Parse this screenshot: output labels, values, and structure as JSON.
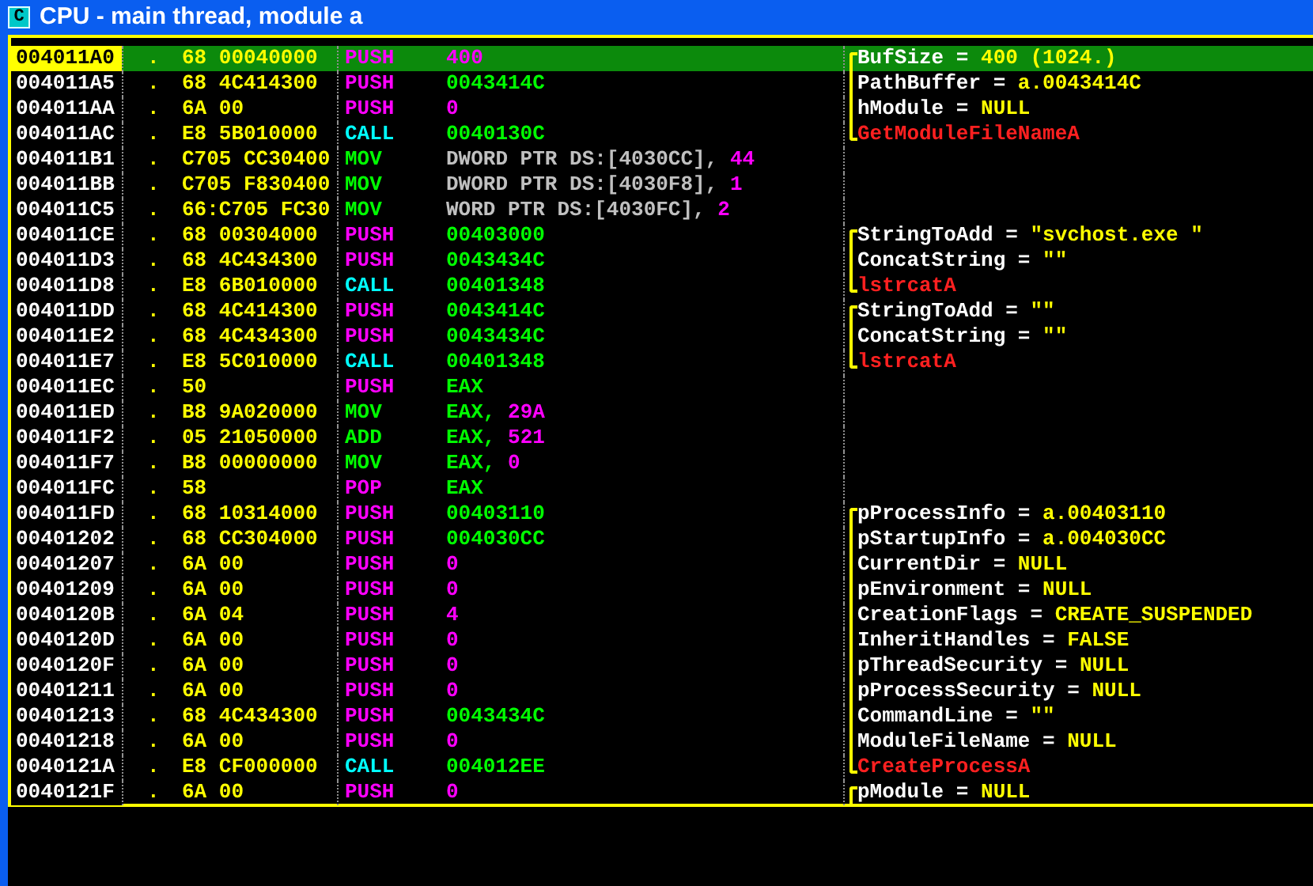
{
  "window": {
    "icon_letter": "C",
    "title": "CPU - main thread, module a"
  },
  "rows": [
    {
      "address": "004011A0",
      "selected": true,
      "dot": ".",
      "hex": "68 00040000",
      "mnemonic": {
        "text": "PUSH",
        "kind": "push"
      },
      "operands": [
        {
          "text": "400",
          "kind": "const"
        }
      ],
      "comment": {
        "kind": "start",
        "parts": [
          {
            "text": "BufSize = ",
            "kind": "name"
          },
          {
            "text": "400 (1024.)",
            "kind": "value"
          }
        ]
      }
    },
    {
      "address": "004011A5",
      "selected": false,
      "dot": ".",
      "hex": "68 4C414300",
      "mnemonic": {
        "text": "PUSH",
        "kind": "push"
      },
      "operands": [
        {
          "text": "0043414C",
          "kind": "addr"
        }
      ],
      "comment": {
        "kind": "mid",
        "parts": [
          {
            "text": "PathBuffer = ",
            "kind": "name"
          },
          {
            "text": "a.0043414C",
            "kind": "value"
          }
        ]
      }
    },
    {
      "address": "004011AA",
      "selected": false,
      "dot": ".",
      "hex": "6A 00",
      "mnemonic": {
        "text": "PUSH",
        "kind": "push"
      },
      "operands": [
        {
          "text": "0",
          "kind": "const"
        }
      ],
      "comment": {
        "kind": "mid",
        "parts": [
          {
            "text": "hModule = ",
            "kind": "name"
          },
          {
            "text": "NULL",
            "kind": "value"
          }
        ]
      }
    },
    {
      "address": "004011AC",
      "selected": false,
      "dot": ".",
      "hex": "E8 5B010000",
      "mnemonic": {
        "text": "CALL",
        "kind": "call"
      },
      "operands": [
        {
          "text": "0040130C",
          "kind": "addr"
        }
      ],
      "comment": {
        "kind": "end",
        "parts": [
          {
            "text": "GetModuleFileNameA",
            "kind": "func"
          }
        ]
      }
    },
    {
      "address": "004011B1",
      "selected": false,
      "dot": ".",
      "hex": "C705 CC30400",
      "mnemonic": {
        "text": "MOV",
        "kind": "mov"
      },
      "operands": [
        {
          "text": "DWORD PTR DS:[4030CC], ",
          "kind": "mem"
        },
        {
          "text": "44",
          "kind": "const"
        }
      ]
    },
    {
      "address": "004011BB",
      "selected": false,
      "dot": ".",
      "hex": "C705 F830400",
      "mnemonic": {
        "text": "MOV",
        "kind": "mov"
      },
      "operands": [
        {
          "text": "DWORD PTR DS:[4030F8], ",
          "kind": "mem"
        },
        {
          "text": "1",
          "kind": "const"
        }
      ]
    },
    {
      "address": "004011C5",
      "selected": false,
      "dot": ".",
      "hex": "66:C705 FC30",
      "mnemonic": {
        "text": "MOV",
        "kind": "mov"
      },
      "operands": [
        {
          "text": "WORD PTR DS:[4030FC], ",
          "kind": "mem"
        },
        {
          "text": "2",
          "kind": "const"
        }
      ]
    },
    {
      "address": "004011CE",
      "selected": false,
      "dot": ".",
      "hex": "68 00304000",
      "mnemonic": {
        "text": "PUSH",
        "kind": "push"
      },
      "operands": [
        {
          "text": "00403000",
          "kind": "addr"
        }
      ],
      "comment": {
        "kind": "start",
        "parts": [
          {
            "text": "StringToAdd = ",
            "kind": "name"
          },
          {
            "text": "\"svchost.exe \"",
            "kind": "value"
          }
        ]
      }
    },
    {
      "address": "004011D3",
      "selected": false,
      "dot": ".",
      "hex": "68 4C434300",
      "mnemonic": {
        "text": "PUSH",
        "kind": "push"
      },
      "operands": [
        {
          "text": "0043434C",
          "kind": "addr"
        }
      ],
      "comment": {
        "kind": "mid",
        "parts": [
          {
            "text": "ConcatString = ",
            "kind": "name"
          },
          {
            "text": "\"\"",
            "kind": "value"
          }
        ]
      }
    },
    {
      "address": "004011D8",
      "selected": false,
      "dot": ".",
      "hex": "E8 6B010000",
      "mnemonic": {
        "text": "CALL",
        "kind": "call"
      },
      "operands": [
        {
          "text": "00401348",
          "kind": "addr"
        }
      ],
      "comment": {
        "kind": "end",
        "parts": [
          {
            "text": "lstrcatA",
            "kind": "func"
          }
        ]
      }
    },
    {
      "address": "004011DD",
      "selected": false,
      "dot": ".",
      "hex": "68 4C414300",
      "mnemonic": {
        "text": "PUSH",
        "kind": "push"
      },
      "operands": [
        {
          "text": "0043414C",
          "kind": "addr"
        }
      ],
      "comment": {
        "kind": "start",
        "parts": [
          {
            "text": "StringToAdd = ",
            "kind": "name"
          },
          {
            "text": "\"\"",
            "kind": "value"
          }
        ]
      }
    },
    {
      "address": "004011E2",
      "selected": false,
      "dot": ".",
      "hex": "68 4C434300",
      "mnemonic": {
        "text": "PUSH",
        "kind": "push"
      },
      "operands": [
        {
          "text": "0043434C",
          "kind": "addr"
        }
      ],
      "comment": {
        "kind": "mid",
        "parts": [
          {
            "text": "ConcatString = ",
            "kind": "name"
          },
          {
            "text": "\"\"",
            "kind": "value"
          }
        ]
      }
    },
    {
      "address": "004011E7",
      "selected": false,
      "dot": ".",
      "hex": "E8 5C010000",
      "mnemonic": {
        "text": "CALL",
        "kind": "call"
      },
      "operands": [
        {
          "text": "00401348",
          "kind": "addr"
        }
      ],
      "comment": {
        "kind": "end",
        "parts": [
          {
            "text": "lstrcatA",
            "kind": "func"
          }
        ]
      }
    },
    {
      "address": "004011EC",
      "selected": false,
      "dot": ".",
      "hex": "50",
      "mnemonic": {
        "text": "PUSH",
        "kind": "push"
      },
      "operands": [
        {
          "text": "EAX",
          "kind": "reg"
        }
      ]
    },
    {
      "address": "004011ED",
      "selected": false,
      "dot": ".",
      "hex": "B8 9A020000",
      "mnemonic": {
        "text": "MOV",
        "kind": "mov"
      },
      "operands": [
        {
          "text": "EAX, ",
          "kind": "reg"
        },
        {
          "text": "29A",
          "kind": "const"
        }
      ]
    },
    {
      "address": "004011F2",
      "selected": false,
      "dot": ".",
      "hex": "05 21050000",
      "mnemonic": {
        "text": "ADD",
        "kind": "mov"
      },
      "operands": [
        {
          "text": "EAX, ",
          "kind": "reg"
        },
        {
          "text": "521",
          "kind": "const"
        }
      ]
    },
    {
      "address": "004011F7",
      "selected": false,
      "dot": ".",
      "hex": "B8 00000000",
      "mnemonic": {
        "text": "MOV",
        "kind": "mov"
      },
      "operands": [
        {
          "text": "EAX, ",
          "kind": "reg"
        },
        {
          "text": "0",
          "kind": "const"
        }
      ]
    },
    {
      "address": "004011FC",
      "selected": false,
      "dot": ".",
      "hex": "58",
      "mnemonic": {
        "text": "POP",
        "kind": "push"
      },
      "operands": [
        {
          "text": "EAX",
          "kind": "reg"
        }
      ]
    },
    {
      "address": "004011FD",
      "selected": false,
      "dot": ".",
      "hex": "68 10314000",
      "mnemonic": {
        "text": "PUSH",
        "kind": "push"
      },
      "operands": [
        {
          "text": "00403110",
          "kind": "addr"
        }
      ],
      "comment": {
        "kind": "start",
        "parts": [
          {
            "text": "pProcessInfo = ",
            "kind": "name"
          },
          {
            "text": "a.00403110",
            "kind": "value"
          }
        ]
      }
    },
    {
      "address": "00401202",
      "selected": false,
      "dot": ".",
      "hex": "68 CC304000",
      "mnemonic": {
        "text": "PUSH",
        "kind": "push"
      },
      "operands": [
        {
          "text": "004030CC",
          "kind": "addr"
        }
      ],
      "comment": {
        "kind": "mid",
        "parts": [
          {
            "text": "pStartupInfo = ",
            "kind": "name"
          },
          {
            "text": "a.004030CC",
            "kind": "value"
          }
        ]
      }
    },
    {
      "address": "00401207",
      "selected": false,
      "dot": ".",
      "hex": "6A 00",
      "mnemonic": {
        "text": "PUSH",
        "kind": "push"
      },
      "operands": [
        {
          "text": "0",
          "kind": "const"
        }
      ],
      "comment": {
        "kind": "mid",
        "parts": [
          {
            "text": "CurrentDir = ",
            "kind": "name"
          },
          {
            "text": "NULL",
            "kind": "value"
          }
        ]
      }
    },
    {
      "address": "00401209",
      "selected": false,
      "dot": ".",
      "hex": "6A 00",
      "mnemonic": {
        "text": "PUSH",
        "kind": "push"
      },
      "operands": [
        {
          "text": "0",
          "kind": "const"
        }
      ],
      "comment": {
        "kind": "mid",
        "parts": [
          {
            "text": "pEnvironment = ",
            "kind": "name"
          },
          {
            "text": "NULL",
            "kind": "value"
          }
        ]
      }
    },
    {
      "address": "0040120B",
      "selected": false,
      "dot": ".",
      "hex": "6A 04",
      "mnemonic": {
        "text": "PUSH",
        "kind": "push"
      },
      "operands": [
        {
          "text": "4",
          "kind": "const"
        }
      ],
      "comment": {
        "kind": "mid",
        "parts": [
          {
            "text": "CreationFlags = ",
            "kind": "name"
          },
          {
            "text": "CREATE_SUSPENDED",
            "kind": "value"
          }
        ]
      }
    },
    {
      "address": "0040120D",
      "selected": false,
      "dot": ".",
      "hex": "6A 00",
      "mnemonic": {
        "text": "PUSH",
        "kind": "push"
      },
      "operands": [
        {
          "text": "0",
          "kind": "const"
        }
      ],
      "comment": {
        "kind": "mid",
        "parts": [
          {
            "text": "InheritHandles = ",
            "kind": "name"
          },
          {
            "text": "FALSE",
            "kind": "value"
          }
        ]
      }
    },
    {
      "address": "0040120F",
      "selected": false,
      "dot": ".",
      "hex": "6A 00",
      "mnemonic": {
        "text": "PUSH",
        "kind": "push"
      },
      "operands": [
        {
          "text": "0",
          "kind": "const"
        }
      ],
      "comment": {
        "kind": "mid",
        "parts": [
          {
            "text": "pThreadSecurity = ",
            "kind": "name"
          },
          {
            "text": "NULL",
            "kind": "value"
          }
        ]
      }
    },
    {
      "address": "00401211",
      "selected": false,
      "dot": ".",
      "hex": "6A 00",
      "mnemonic": {
        "text": "PUSH",
        "kind": "push"
      },
      "operands": [
        {
          "text": "0",
          "kind": "const"
        }
      ],
      "comment": {
        "kind": "mid",
        "parts": [
          {
            "text": "pProcessSecurity = ",
            "kind": "name"
          },
          {
            "text": "NULL",
            "kind": "value"
          }
        ]
      }
    },
    {
      "address": "00401213",
      "selected": false,
      "dot": ".",
      "hex": "68 4C434300",
      "mnemonic": {
        "text": "PUSH",
        "kind": "push"
      },
      "operands": [
        {
          "text": "0043434C",
          "kind": "addr"
        }
      ],
      "comment": {
        "kind": "mid",
        "parts": [
          {
            "text": "CommandLine = ",
            "kind": "name"
          },
          {
            "text": "\"\"",
            "kind": "value"
          }
        ]
      }
    },
    {
      "address": "00401218",
      "selected": false,
      "dot": ".",
      "hex": "6A 00",
      "mnemonic": {
        "text": "PUSH",
        "kind": "push"
      },
      "operands": [
        {
          "text": "0",
          "kind": "const"
        }
      ],
      "comment": {
        "kind": "mid",
        "parts": [
          {
            "text": "ModuleFileName = ",
            "kind": "name"
          },
          {
            "text": "NULL",
            "kind": "value"
          }
        ]
      }
    },
    {
      "address": "0040121A",
      "selected": false,
      "dot": ".",
      "hex": "E8 CF000000",
      "mnemonic": {
        "text": "CALL",
        "kind": "call"
      },
      "operands": [
        {
          "text": "004012EE",
          "kind": "addr"
        }
      ],
      "comment": {
        "kind": "end",
        "parts": [
          {
            "text": "CreateProcessA",
            "kind": "func"
          }
        ]
      }
    },
    {
      "address": "0040121F",
      "selected": false,
      "dot": ".",
      "hex": "6A 00",
      "mnemonic": {
        "text": "PUSH",
        "kind": "push"
      },
      "operands": [
        {
          "text": "0",
          "kind": "const"
        }
      ],
      "comment": {
        "kind": "start",
        "parts": [
          {
            "text": "pModule = ",
            "kind": "name"
          },
          {
            "text": "NULL",
            "kind": "value"
          }
        ]
      }
    }
  ]
}
